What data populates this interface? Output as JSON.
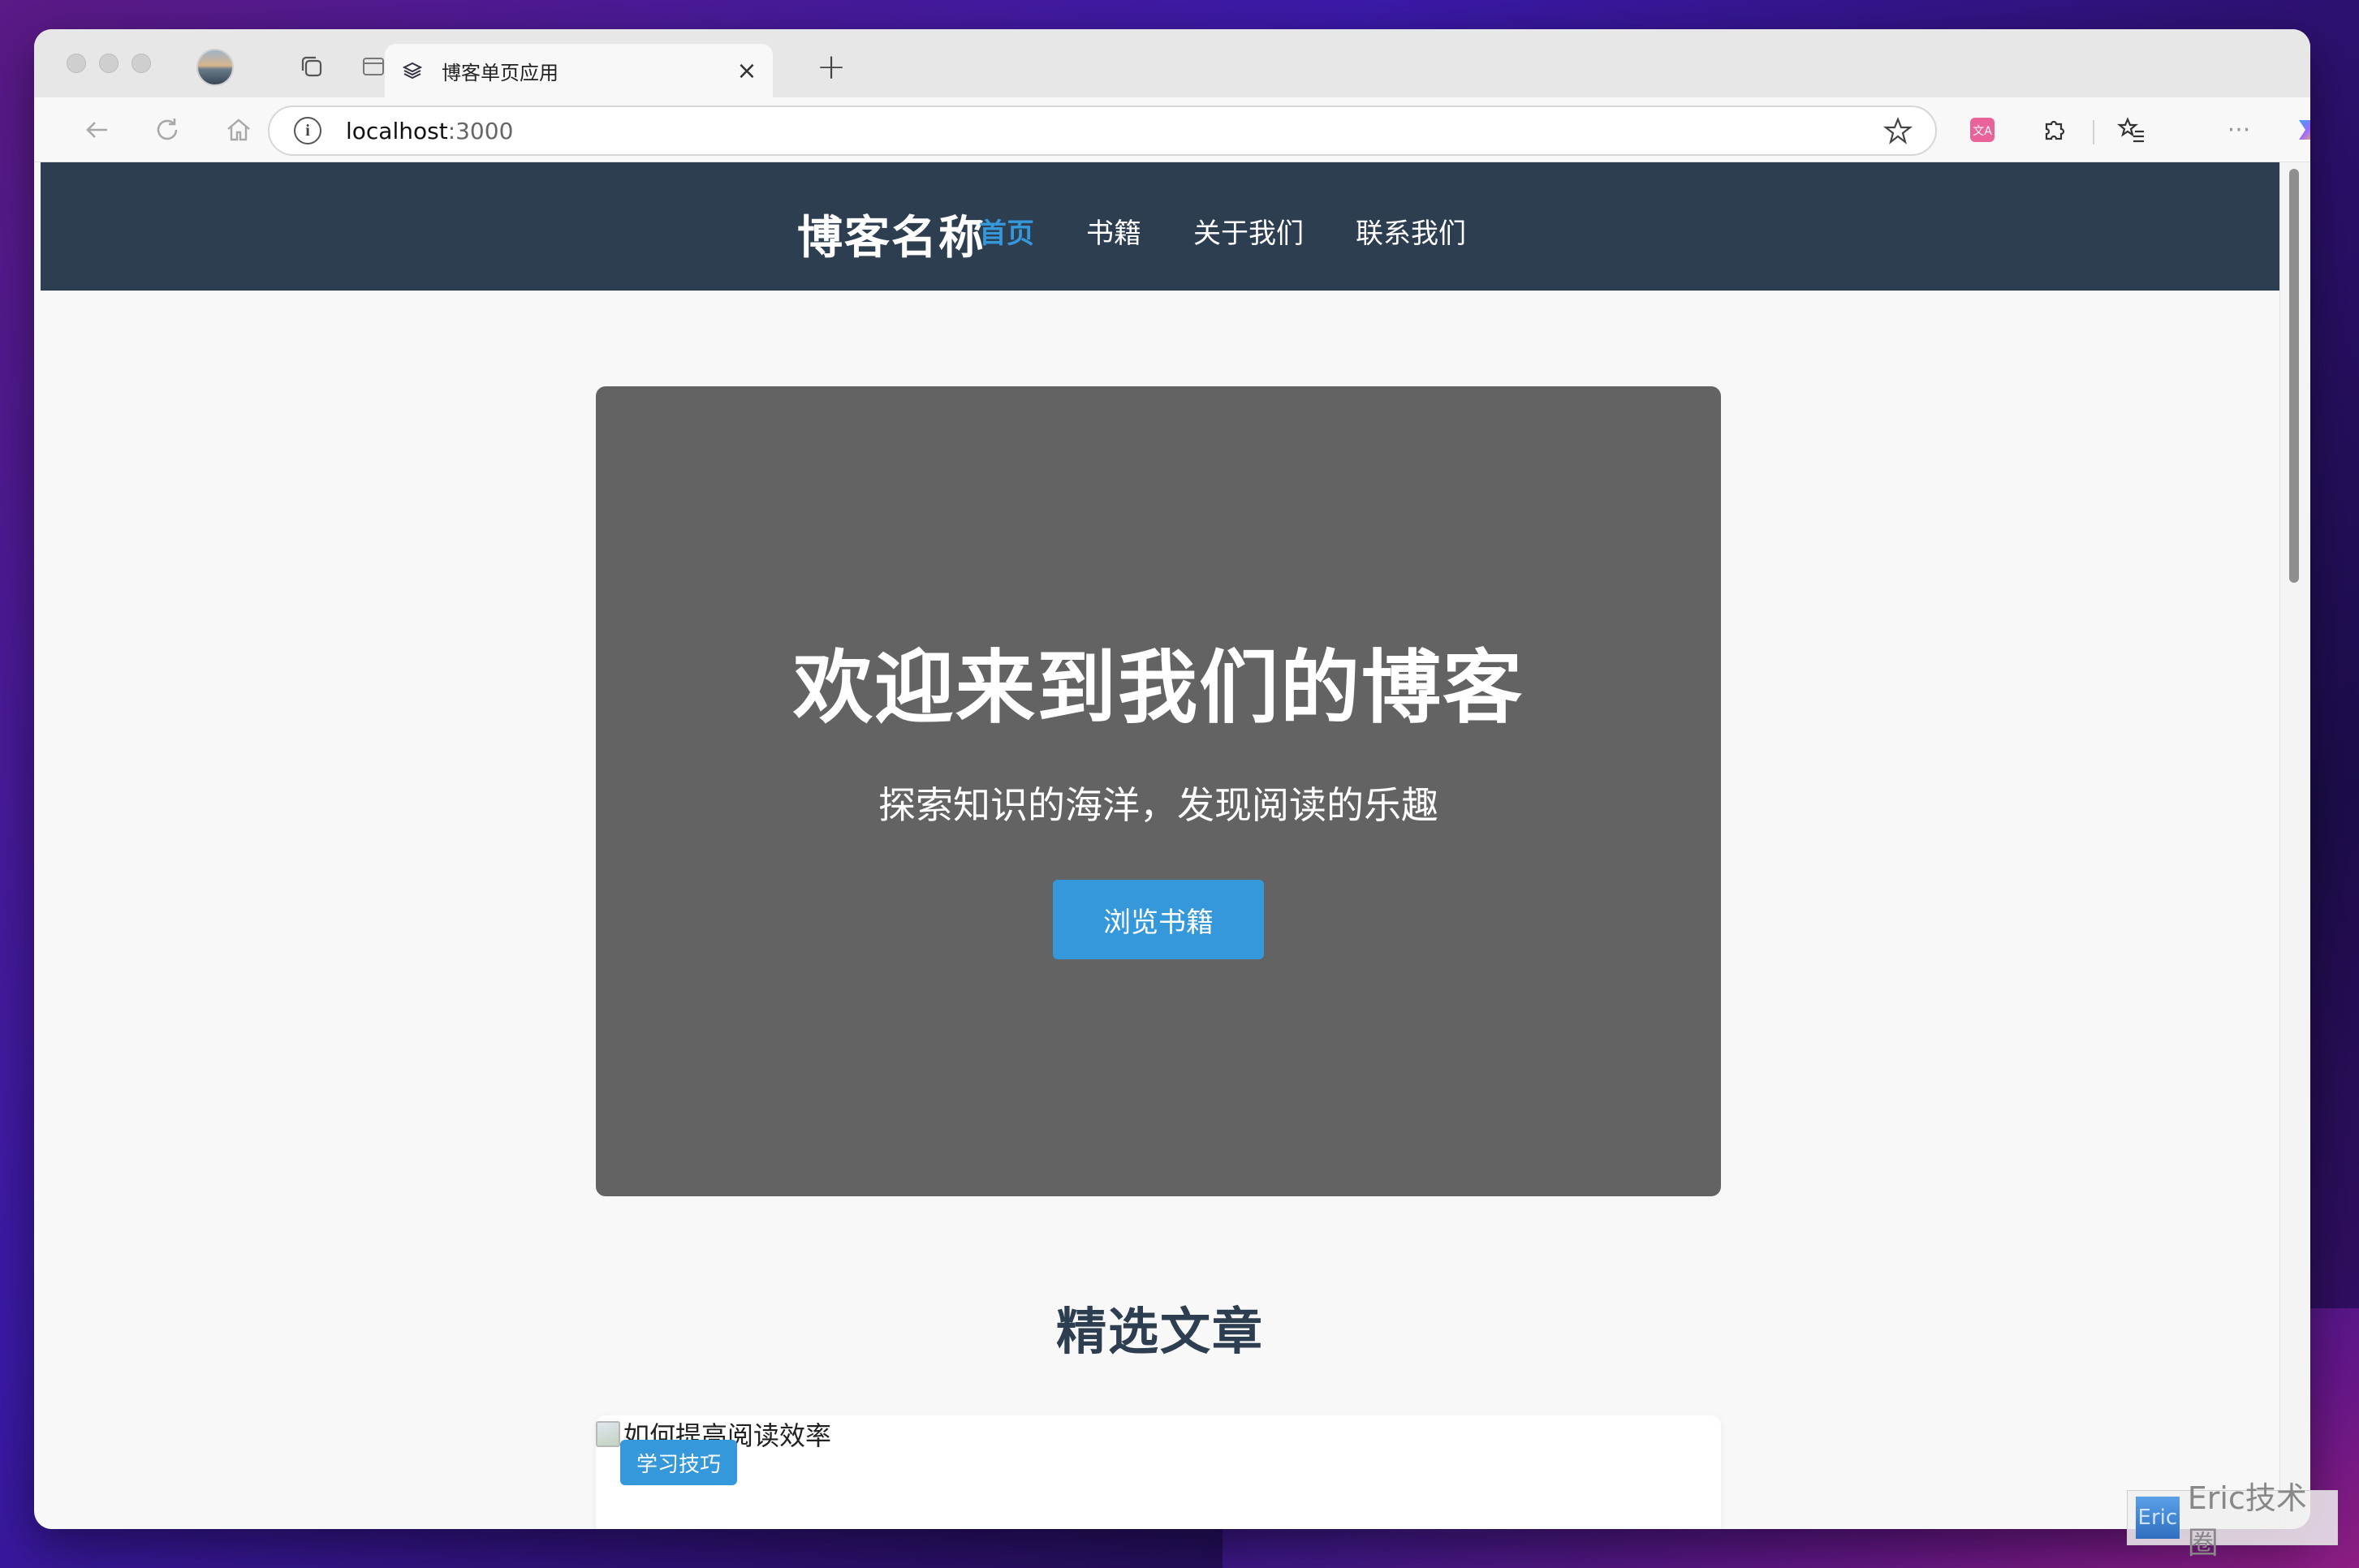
{
  "browser": {
    "tab": {
      "title": "博客单页应用"
    },
    "address_bar": {
      "host": "localhost",
      "port": ":3000"
    }
  },
  "site": {
    "brand": "博客名称",
    "nav": [
      {
        "label": "首页",
        "active": true
      },
      {
        "label": "书籍",
        "active": false
      },
      {
        "label": "关于我们",
        "active": false
      },
      {
        "label": "联系我们",
        "active": false
      }
    ],
    "hero": {
      "title": "欢迎来到我们的博客",
      "subtitle": "探索知识的海洋，发现阅读的乐趣",
      "button_label": "浏览书籍"
    },
    "featured": {
      "section_title": "精选文章",
      "articles": [
        {
          "image_alt": "如何提高阅读效率",
          "tag": "学习技巧"
        }
      ]
    }
  },
  "watermark": {
    "logo_text": "Eric",
    "text": "Eric技术圈"
  },
  "colors": {
    "header_bg": "#2d3e50",
    "accent": "#3498db",
    "hero_bg": "#636363"
  }
}
